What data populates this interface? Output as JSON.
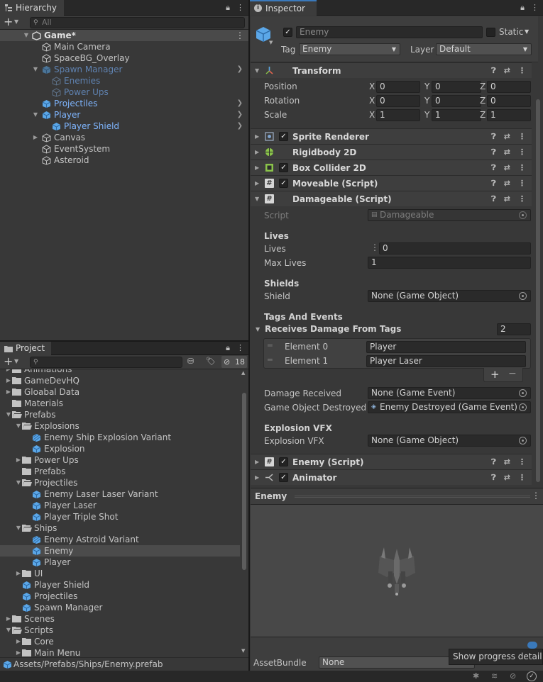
{
  "hierarchy": {
    "tab_label": "Hierarchy",
    "search_placeholder": "All",
    "items": [
      {
        "label": "Game*",
        "type": "scene"
      },
      {
        "label": "Main Camera",
        "type": "gameobject"
      },
      {
        "label": "SpaceBG_Overlay",
        "type": "gameobject"
      },
      {
        "label": "Spawn Manager",
        "type": "prefab"
      },
      {
        "label": "Enemies",
        "type": "gameobject-prefab-child"
      },
      {
        "label": "Power Ups",
        "type": "gameobject-prefab-child"
      },
      {
        "label": "Projectiles",
        "type": "prefab"
      },
      {
        "label": "Player",
        "type": "prefab"
      },
      {
        "label": "Player Shield",
        "type": "prefab"
      },
      {
        "label": "Canvas",
        "type": "gameobject"
      },
      {
        "label": "EventSystem",
        "type": "gameobject"
      },
      {
        "label": "Asteroid",
        "type": "gameobject"
      }
    ]
  },
  "project": {
    "tab_label": "Project",
    "hidden_count": "18",
    "items": [
      {
        "label": "Animations",
        "type": "folder"
      },
      {
        "label": "GameDevHQ",
        "type": "folder"
      },
      {
        "label": "Gloabal Data",
        "type": "folder"
      },
      {
        "label": "Materials",
        "type": "folder"
      },
      {
        "label": "Prefabs",
        "type": "folder-open"
      },
      {
        "label": "Explosions",
        "type": "folder-open"
      },
      {
        "label": "Enemy Ship Explosion Variant",
        "type": "prefab-variant"
      },
      {
        "label": "Explosion",
        "type": "prefab"
      },
      {
        "label": "Power Ups",
        "type": "folder"
      },
      {
        "label": "Prefabs",
        "type": "folder"
      },
      {
        "label": "Projectiles",
        "type": "folder-open"
      },
      {
        "label": "Enemy Laser Laser Variant",
        "type": "prefab"
      },
      {
        "label": "Player Laser",
        "type": "prefab"
      },
      {
        "label": "Player Triple Shot",
        "type": "prefab"
      },
      {
        "label": "Ships",
        "type": "folder-open"
      },
      {
        "label": "Enemy Astroid Variant",
        "type": "prefab-variant"
      },
      {
        "label": "Enemy",
        "type": "prefab"
      },
      {
        "label": "Player",
        "type": "prefab"
      },
      {
        "label": "UI",
        "type": "folder"
      },
      {
        "label": "Player Shield",
        "type": "prefab"
      },
      {
        "label": "Projectiles",
        "type": "prefab"
      },
      {
        "label": "Spawn Manager",
        "type": "prefab"
      },
      {
        "label": "Scenes",
        "type": "folder"
      },
      {
        "label": "Scripts",
        "type": "folder-open"
      },
      {
        "label": "Core",
        "type": "folder"
      },
      {
        "label": "Main Menu",
        "type": "folder"
      }
    ],
    "path": "Assets/Prefabs/Ships/Enemy.prefab"
  },
  "inspector": {
    "tab_label": "Inspector",
    "object_name": "Enemy",
    "static_label": "Static",
    "tag_label": "Tag",
    "tag_value": "Enemy",
    "layer_label": "Layer",
    "layer_value": "Default",
    "transform": {
      "title": "Transform",
      "position_label": "Position",
      "rotation_label": "Rotation",
      "scale_label": "Scale",
      "axis_x": "X",
      "axis_y": "Y",
      "axis_z": "Z",
      "position": [
        "0",
        "0",
        "0"
      ],
      "rotation": [
        "0",
        "0",
        "0"
      ],
      "scale": [
        "1",
        "1",
        "1"
      ]
    },
    "components": {
      "sprite_renderer": "Sprite Renderer",
      "rigidbody": "Rigidbody 2D",
      "box_collider": "Box Collider 2D",
      "moveable": "Moveable (Script)",
      "damageable": "Damageable (Script)",
      "enemy": "Enemy (Script)",
      "animator": "Animator"
    },
    "damageable": {
      "script_label": "Script",
      "script_value": "Damageable",
      "lives_header": "Lives",
      "lives_label": "Lives",
      "lives_value": "0",
      "max_lives_label": "Max Lives",
      "max_lives_value": "1",
      "shields_header": "Shields",
      "shield_label": "Shield",
      "shield_value": "None (Game Object)",
      "tags_header": "Tags And Events",
      "receives_label": "Receives Damage From Tags",
      "receives_count": "2",
      "elements": [
        {
          "label": "Element 0",
          "value": "Player"
        },
        {
          "label": "Element 1",
          "value": "Player Laser"
        }
      ],
      "damage_received_label": "Damage Received",
      "damage_received_value": "None (Game Event)",
      "destroyed_label": "Game Object Destroyed",
      "destroyed_value": "Enemy Destroyed (Game Event)",
      "vfx_header": "Explosion VFX",
      "vfx_label": "Explosion VFX",
      "vfx_value": "None (Game Object)"
    },
    "preview_title": "Enemy",
    "assetbundle_label": "AssetBundle",
    "assetbundle_value": "None",
    "tooltip": "Show progress details"
  },
  "colors": {
    "panel_bg": "#383838",
    "selection": "#4b4b4b",
    "prefab_blue": "#7fb6ff",
    "accent_blue": "#3a79bb"
  }
}
